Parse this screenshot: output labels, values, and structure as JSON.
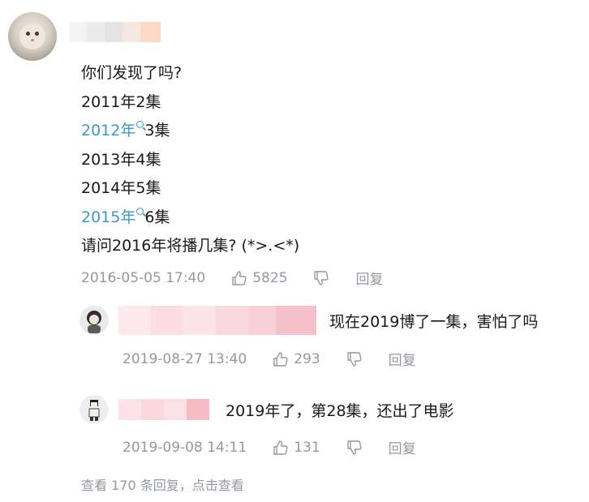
{
  "comment": {
    "lines": [
      {
        "text": "你们发现了吗?"
      },
      {
        "text": "2011年2集"
      },
      {
        "link": "2012年",
        "after": "3集"
      },
      {
        "text": "2013年4集"
      },
      {
        "text": "2014年5集"
      },
      {
        "link": "2015年",
        "after": "6集"
      },
      {
        "text": "请问2016年将播几集? (*>.<*)"
      }
    ],
    "timestamp": "2016-05-05 17:40",
    "likes": "5825",
    "reply_label": "回复"
  },
  "replies": [
    {
      "text": "现在2019博了一集，害怕了吗",
      "timestamp": "2019-08-27 13:40",
      "likes": "293",
      "reply_label": "回复"
    },
    {
      "text": "2019年了，第28集，还出了电影",
      "timestamp": "2019-09-08 14:11",
      "likes": "131",
      "reply_label": "回复"
    }
  ],
  "view_more": "查看 170 条回复，点击查看",
  "colors": {
    "link": "#3b9ac9",
    "meta": "#9499a0",
    "text": "#18191c",
    "name_blur": "#f7c6cf"
  },
  "icons": {
    "like": "thumbs-up-icon",
    "dislike": "thumbs-down-icon",
    "search": "search-icon"
  }
}
